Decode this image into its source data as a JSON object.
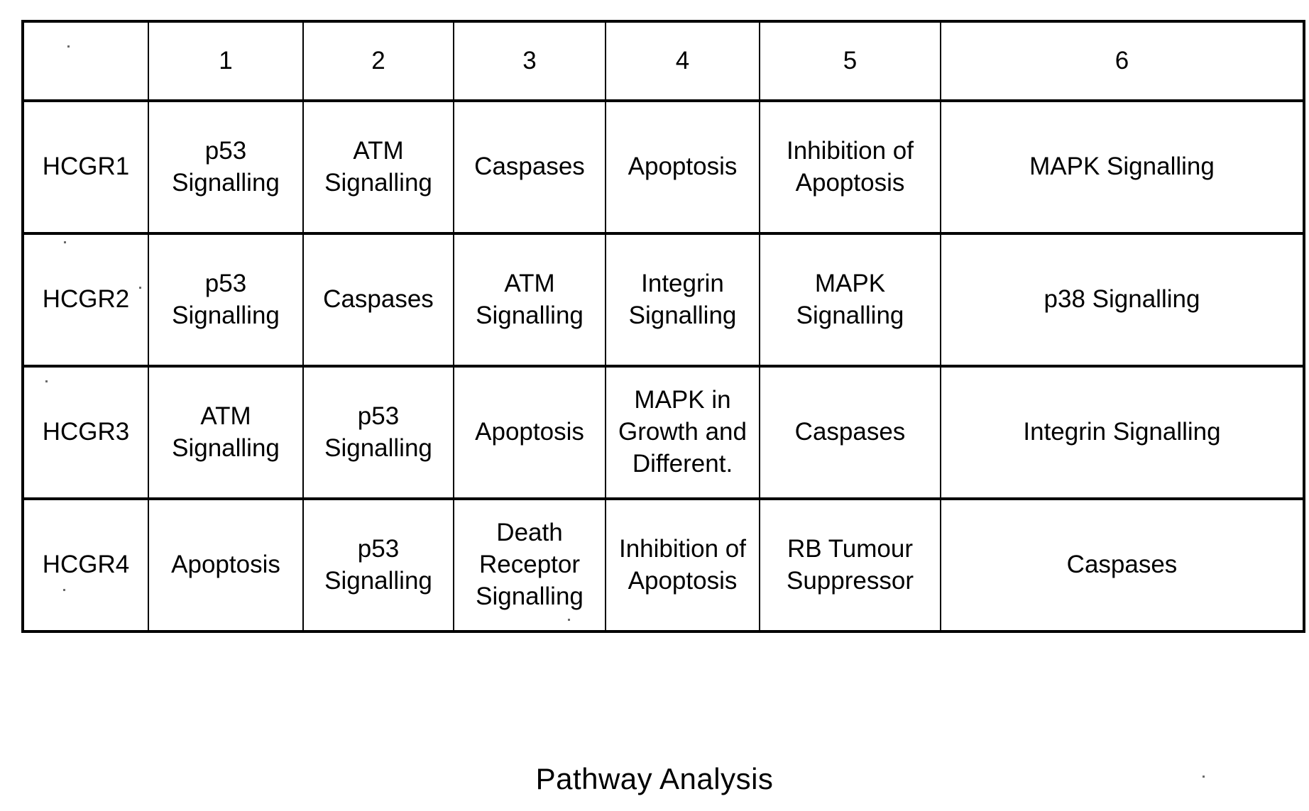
{
  "table": {
    "column_headers": [
      "",
      "1",
      "2",
      "3",
      "4",
      "5",
      "6"
    ],
    "rows": [
      {
        "label": "HCGR1",
        "cells": [
          "p53 Signalling",
          "ATM Signalling",
          "Caspases",
          "Apoptosis",
          "Inhibition of Apoptosis",
          "MAPK Signalling"
        ]
      },
      {
        "label": "HCGR2",
        "cells": [
          "p53 Signalling",
          "Caspases",
          "ATM Signalling",
          "Integrin Signalling",
          "MAPK Signalling",
          "p38 Signalling"
        ]
      },
      {
        "label": "HCGR3",
        "cells": [
          "ATM Signalling",
          "p53 Signalling",
          "Apoptosis",
          "MAPK in Growth and Different.",
          "Caspases",
          "Integrin Signalling"
        ]
      },
      {
        "label": "HCGR4",
        "cells": [
          "Apoptosis",
          "p53 Signalling",
          "Death Receptor Signalling",
          "Inhibition of Apoptosis",
          "RB Tumour Suppressor",
          "Caspases"
        ]
      }
    ]
  },
  "caption": "Pathway Analysis"
}
